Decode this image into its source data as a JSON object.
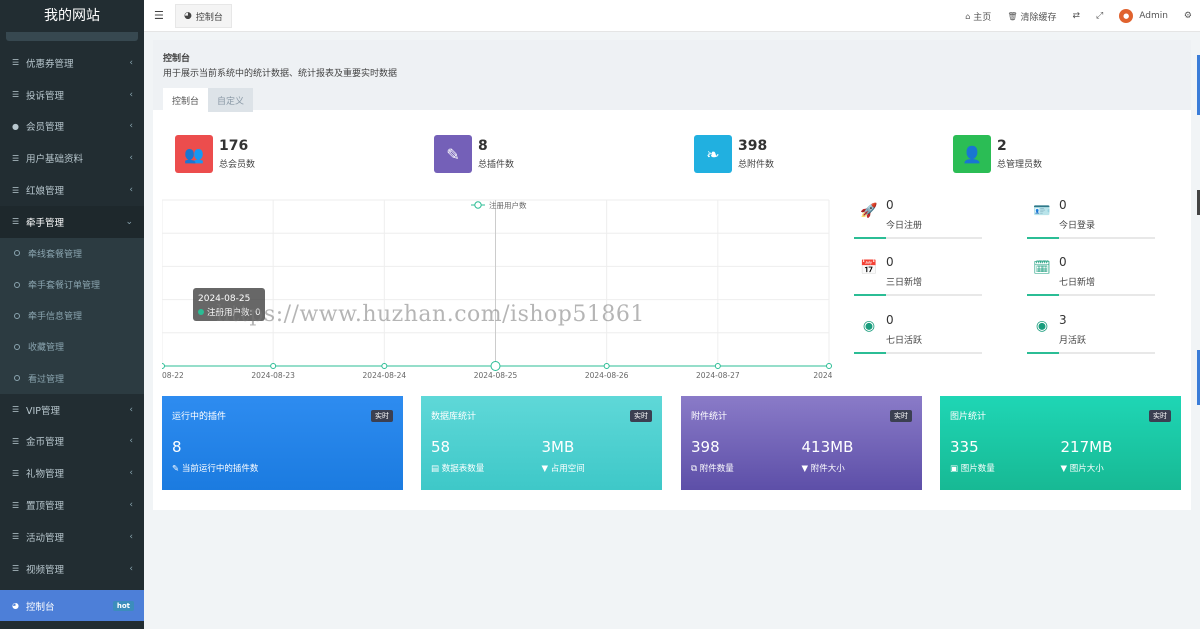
{
  "app": {
    "site_title": "我的网站"
  },
  "sidebar": {
    "items": [
      {
        "label": "优惠券管理",
        "icon": "list-icon"
      },
      {
        "label": "投诉管理",
        "icon": "list-icon"
      },
      {
        "label": "会员管理",
        "icon": "user-circle-icon"
      },
      {
        "label": "用户基础资料",
        "icon": "list-icon"
      },
      {
        "label": "红娘管理",
        "icon": "list-icon"
      },
      {
        "label": "牵手管理",
        "icon": "list-icon"
      }
    ],
    "subitems": [
      "牵线套餐管理",
      "牵手套餐订单管理",
      "牵手信息管理",
      "收藏管理",
      "看过管理"
    ],
    "items2": [
      {
        "label": "VIP管理"
      },
      {
        "label": "金币管理"
      },
      {
        "label": "礼物管理"
      },
      {
        "label": "置顶管理"
      },
      {
        "label": "活动管理"
      },
      {
        "label": "视频管理"
      }
    ],
    "active": {
      "label": "控制台",
      "badge": "hot"
    }
  },
  "header": {
    "tab_label": "控制台",
    "home": "主页",
    "clear_cache": "清除缓存",
    "user": "Admin"
  },
  "page": {
    "title": "控制台",
    "subtitle": "用于展示当前系统中的统计数据、统计报表及重要实时数据",
    "tabs": [
      "控制台",
      "自定义"
    ]
  },
  "stats": [
    {
      "value": "176",
      "label": "总会员数",
      "color": "#ec4d4d",
      "icon": "users-icon"
    },
    {
      "value": "8",
      "label": "总插件数",
      "color": "#7460b8",
      "icon": "magic-wand-icon"
    },
    {
      "value": "398",
      "label": "总附件数",
      "color": "#21b0e0",
      "icon": "leaf-icon"
    },
    {
      "value": "2",
      "label": "总管理员数",
      "color": "#2bbd55",
      "icon": "user-icon"
    }
  ],
  "mini_stats": [
    {
      "value": "0",
      "label": "今日注册",
      "icon": "rocket-icon"
    },
    {
      "value": "0",
      "label": "今日登录",
      "icon": "id-card-icon"
    },
    {
      "value": "0",
      "label": "三日新增",
      "icon": "calendar-icon"
    },
    {
      "value": "0",
      "label": "七日新增",
      "icon": "calendar-plus-icon"
    },
    {
      "value": "0",
      "label": "七日活跃",
      "icon": "user-circle-icon"
    },
    {
      "value": "3",
      "label": "月活跃",
      "icon": "user-circle-icon"
    }
  ],
  "chart_data": {
    "type": "line",
    "legend": "注册用户数",
    "categories": [
      "08-22",
      "2024-08-23",
      "2024-08-24",
      "2024-08-25",
      "2024-08-26",
      "2024-08-27",
      "2024-08"
    ],
    "series": [
      {
        "name": "注册用户数",
        "values": [
          0,
          0,
          0,
          0,
          0,
          0,
          0
        ]
      }
    ],
    "tooltip": {
      "date": "2024-08-25",
      "label": "注册用户数: 0"
    },
    "color": "#2bbd95"
  },
  "watermark": "https://www.huzhan.com/ishop51861",
  "cards": [
    {
      "title": "运行中的插件",
      "badge": "实时",
      "gradient": [
        "#2e8cf0",
        "#1b7be0"
      ],
      "values": [
        {
          "big": "8",
          "small": "当前运行中的插件数",
          "icon": "magic-icon"
        }
      ]
    },
    {
      "title": "数据库统计",
      "badge": "实时",
      "gradient": [
        "#5fd8d8",
        "#3ec8c8"
      ],
      "values": [
        {
          "big": "58",
          "small": "数据表数量",
          "icon": "database-icon"
        },
        {
          "big": "3MB",
          "small": "占用空间",
          "icon": "filter-icon"
        }
      ]
    },
    {
      "title": "附件统计",
      "badge": "实时",
      "gradient": [
        "#8a7bc8",
        "#5d4fa8"
      ],
      "values": [
        {
          "big": "398",
          "small": "附件数量",
          "icon": "files-icon"
        },
        {
          "big": "413MB",
          "small": "附件大小",
          "icon": "filter-icon"
        }
      ]
    },
    {
      "title": "图片统计",
      "badge": "实时",
      "gradient": [
        "#1fd6b5",
        "#17b994"
      ],
      "values": [
        {
          "big": "335",
          "small": "图片数量",
          "icon": "image-icon"
        },
        {
          "big": "217MB",
          "small": "图片大小",
          "icon": "filter-icon"
        }
      ]
    }
  ]
}
